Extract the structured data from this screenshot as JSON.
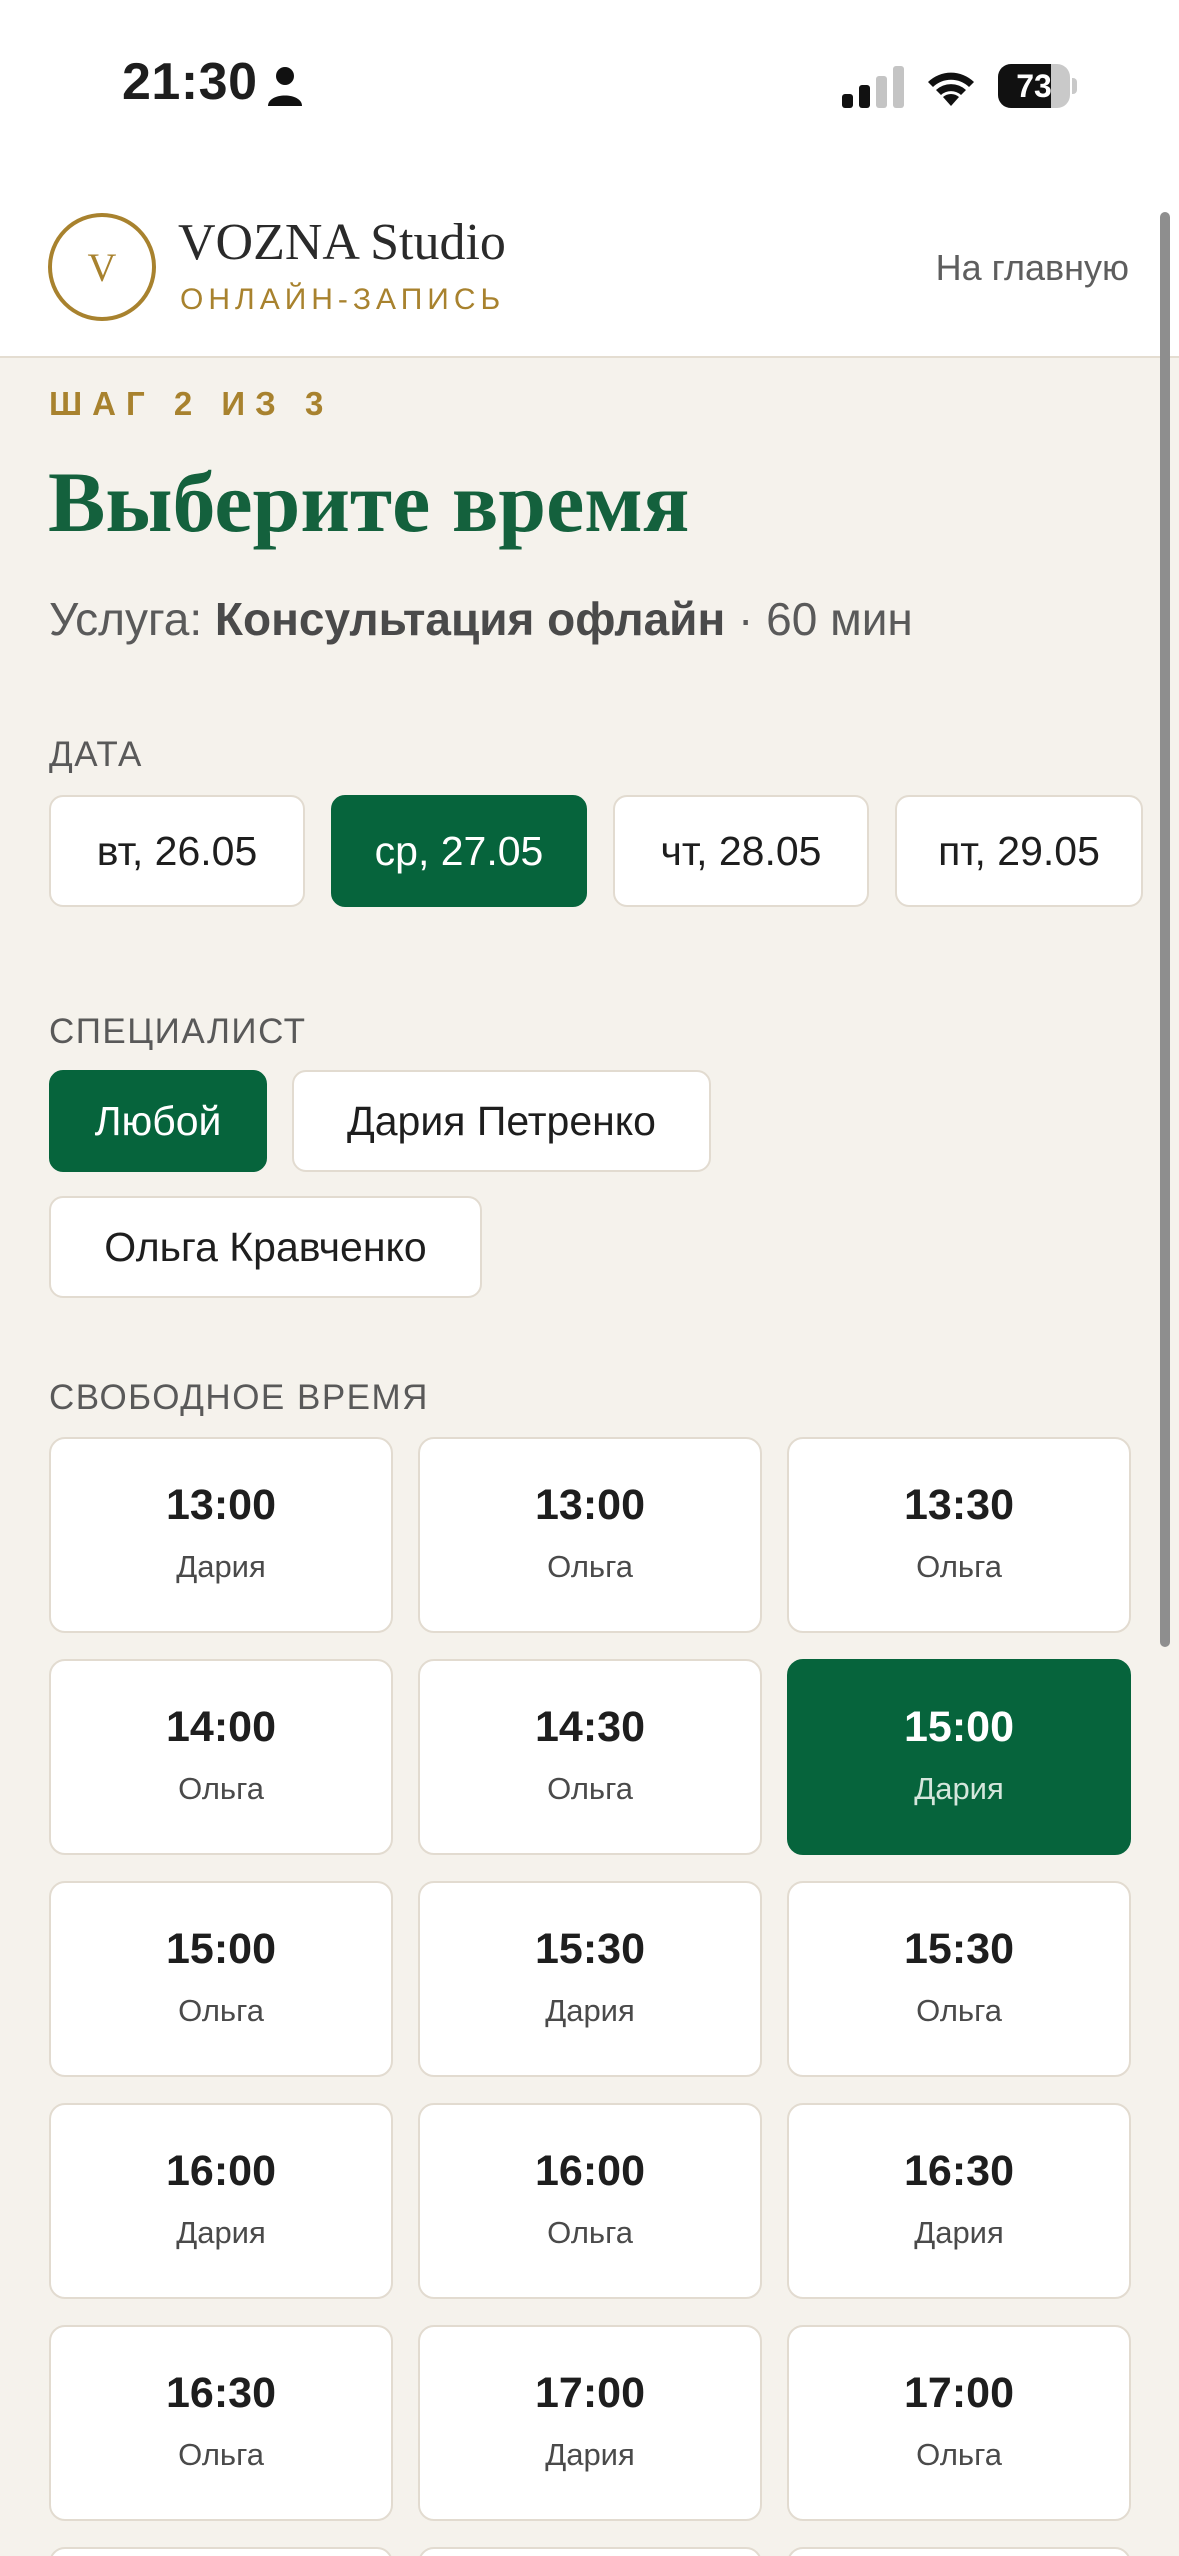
{
  "status_bar": {
    "time": "21:30",
    "battery": "73",
    "battery_level_percent": 73,
    "icons": [
      "person-icon",
      "signal-icon",
      "wifi-icon",
      "battery-icon"
    ]
  },
  "header": {
    "logo_letter": "V",
    "brand_name": "VOZNA Studio",
    "brand_subtitle": "ОНЛАЙН-ЗАПИСЬ",
    "home_link": "На главную"
  },
  "step_label": "ШАГ 2 ИЗ 3",
  "title": "Выберите время",
  "service": {
    "prefix": "Услуга:",
    "name": "Консультация офлайн",
    "duration": "· 60 мин"
  },
  "date_section": {
    "label": "ДАТА",
    "dates": [
      "вт, 26.05",
      "ср, 27.05",
      "чт, 28.05",
      "пт, 29.05"
    ],
    "selected": "ср, 27.05"
  },
  "specialist_section": {
    "label": "СПЕЦИАЛИСТ",
    "options": [
      "Любой",
      "Дария Петренко",
      "Ольга Кравченко"
    ],
    "selected": "Любой"
  },
  "slots_section": {
    "label": "СВОБОДНОЕ ВРЕМЯ",
    "slots": [
      {
        "time": "13:00",
        "name": "Дария"
      },
      {
        "time": "13:00",
        "name": "Ольга"
      },
      {
        "time": "13:30",
        "name": "Ольга"
      },
      {
        "time": "14:00",
        "name": "Ольга"
      },
      {
        "time": "14:30",
        "name": "Ольга"
      },
      {
        "time": "15:00",
        "name": "Дария"
      },
      {
        "time": "15:00",
        "name": "Ольга"
      },
      {
        "time": "15:30",
        "name": "Дария"
      },
      {
        "time": "15:30",
        "name": "Ольга"
      },
      {
        "time": "16:00",
        "name": "Дария"
      },
      {
        "time": "16:00",
        "name": "Ольга"
      },
      {
        "time": "16:30",
        "name": "Дария"
      },
      {
        "time": "16:30",
        "name": "Ольга"
      },
      {
        "time": "17:00",
        "name": "Дария"
      },
      {
        "time": "17:00",
        "name": "Ольга"
      }
    ],
    "selected": {
      "time": "15:00",
      "name": "Дария"
    }
  },
  "colors": {
    "accent_green": "#06643c",
    "gold": "#a8822e",
    "background": "#f5f2ec"
  }
}
